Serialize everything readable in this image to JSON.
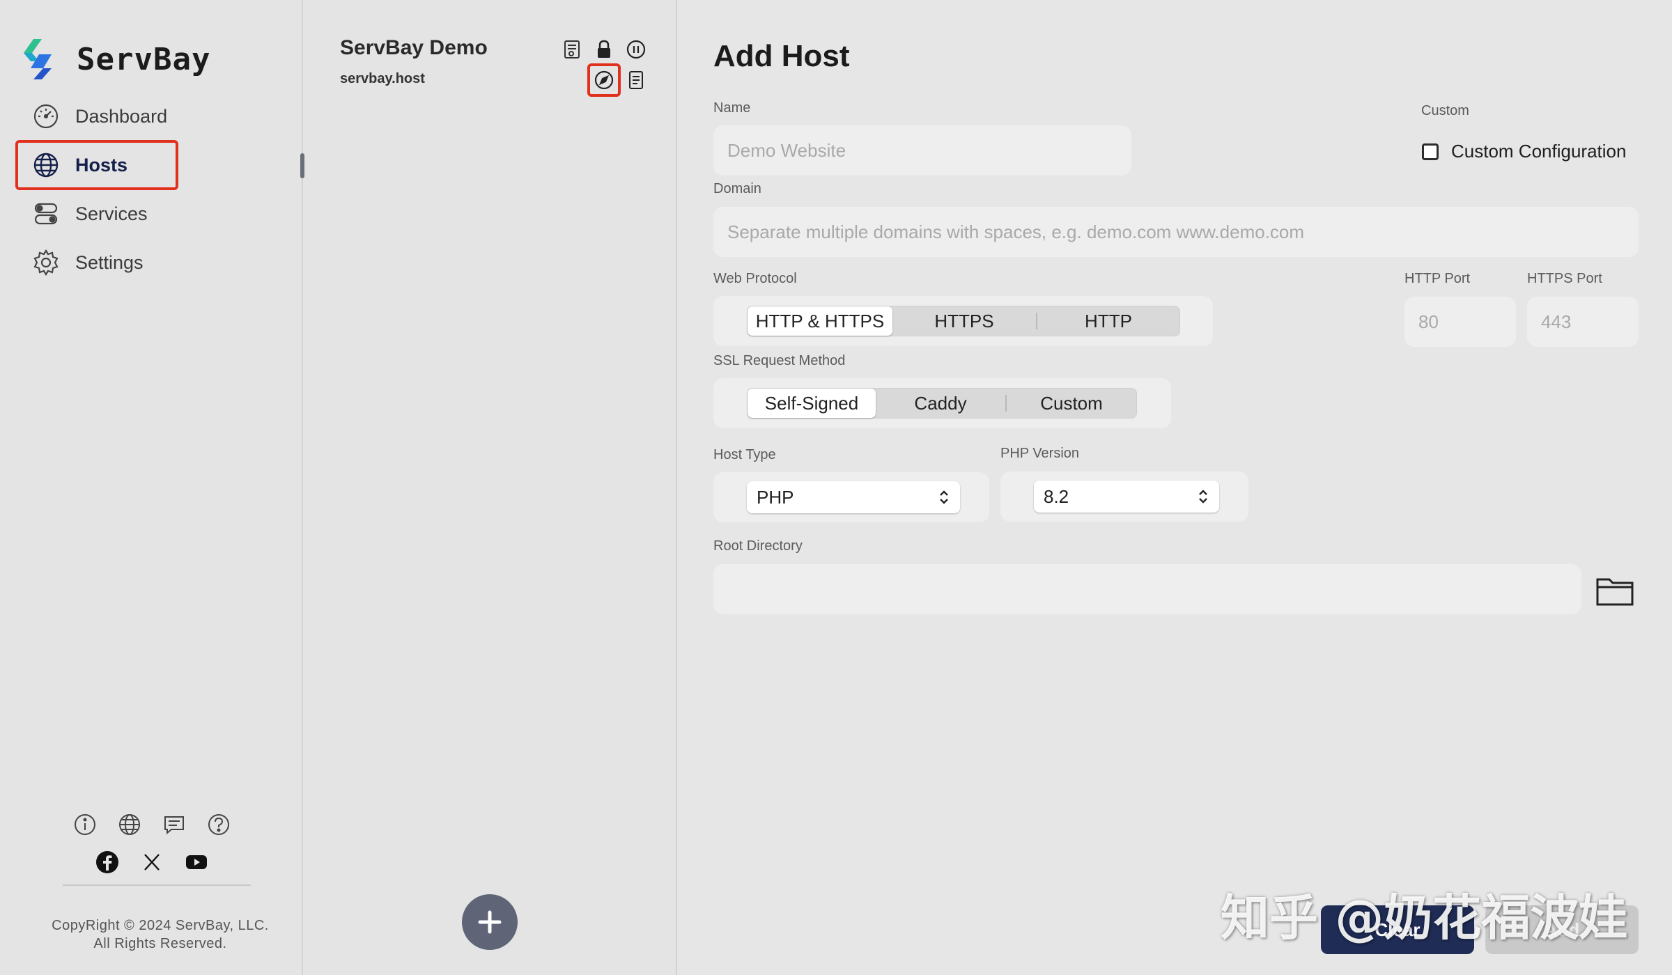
{
  "app": {
    "name": "ServBay"
  },
  "sidebar": {
    "items": [
      {
        "label": "Dashboard",
        "icon": "dashboard-gauge-icon"
      },
      {
        "label": "Hosts",
        "icon": "globe-icon",
        "active": true
      },
      {
        "label": "Services",
        "icon": "toggles-icon"
      },
      {
        "label": "Settings",
        "icon": "gear-icon"
      }
    ],
    "footer_icons": [
      "info-icon",
      "globe-icon",
      "chat-icon",
      "help-icon"
    ],
    "social_icons": [
      "facebook-icon",
      "x-icon",
      "youtube-icon"
    ],
    "copyright_line1": "CopyRight © 2024 ServBay, LLC.",
    "copyright_line2": "All Rights Reserved."
  },
  "hosts_list": {
    "items": [
      {
        "name": "ServBay Demo",
        "domain": "servbay.host",
        "icons_row1": [
          "certificate-icon",
          "lock-icon",
          "pause-icon"
        ],
        "icons_row2": [
          "compass-icon",
          "document-icon"
        ]
      }
    ]
  },
  "form": {
    "title": "Add Host",
    "name_label": "Name",
    "name_placeholder": "Demo Website",
    "custom_label": "Custom",
    "custom_config_label": "Custom Configuration",
    "domain_label": "Domain",
    "domain_placeholder": "Separate multiple domains with spaces, e.g. demo.com www.demo.com",
    "web_protocol_label": "Web Protocol",
    "web_protocol_options": [
      "HTTP & HTTPS",
      "HTTPS",
      "HTTP"
    ],
    "web_protocol_selected": "HTTP & HTTPS",
    "http_port_label": "HTTP Port",
    "http_port_placeholder": "80",
    "https_port_label": "HTTPS Port",
    "https_port_placeholder": "443",
    "ssl_label": "SSL Request Method",
    "ssl_options": [
      "Self-Signed",
      "Caddy",
      "Custom"
    ],
    "ssl_selected": "Self-Signed",
    "host_type_label": "Host Type",
    "host_type_value": "PHP",
    "php_version_label": "PHP Version",
    "php_version_value": "8.2",
    "root_dir_label": "Root Directory",
    "root_dir_value": "",
    "clear_label": "Clear",
    "add_label": "Add"
  },
  "watermark": "知乎 @奶花福波娃",
  "colors": {
    "highlight": "#e0301e",
    "primary_button": "#1f2c55",
    "fab": "#5f6477"
  }
}
